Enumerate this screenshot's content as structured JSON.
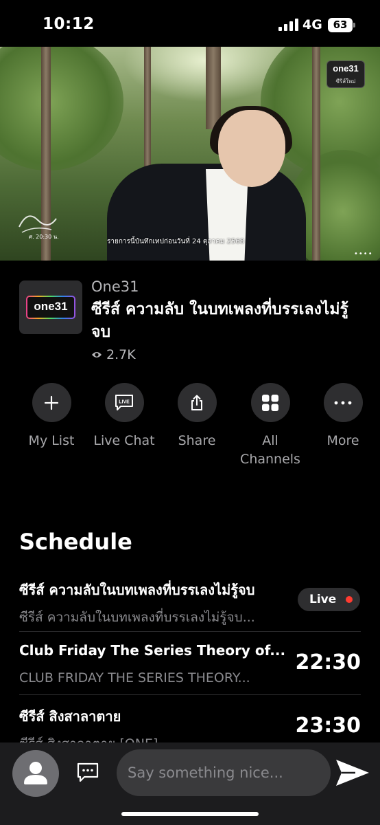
{
  "status_bar": {
    "time": "10:12",
    "network": "4G",
    "battery": "63"
  },
  "video": {
    "channel_logo": "one31",
    "channel_logo_sub": "ซีรีส์ใหม่",
    "watermark_time": "ศ. 20:30 น.",
    "subtitle": "รายการนี้บันทึกเทปก่อนวันที่ 24 ตุลาคม 2568",
    "more_dots": "••••"
  },
  "channel": {
    "badge": "one31",
    "name": "One31",
    "program_title": "ซีรีส์ ความลับ ในบทเพลงที่บรรเลงไม่รู้จบ",
    "views": "2.7K"
  },
  "actions": [
    {
      "label": "My List",
      "icon": "plus-icon"
    },
    {
      "label": "Live Chat",
      "icon": "live-chat-icon",
      "icon_text": "LIVE"
    },
    {
      "label": "Share",
      "icon": "share-icon"
    },
    {
      "label": "All Channels",
      "icon": "grid-icon"
    },
    {
      "label": "More",
      "icon": "ellipsis-icon"
    }
  ],
  "schedule": {
    "title": "Schedule",
    "items": [
      {
        "title": "ซีรีส์ ความลับในบทเพลงที่บรรเลงไม่รู้จบ",
        "subtitle": "ซีรีส์ ความลับในบทเพลงที่บรรเลงไม่รู้จบ...",
        "status": "Live"
      },
      {
        "title": "Club Friday The Series Theory of...",
        "subtitle": "CLUB FRIDAY THE SERIES THEORY...",
        "time": "22:30"
      },
      {
        "title": "ซีรีส์ สิงสาลาตาย",
        "subtitle": "ซีรีส์ สิงสาลาตาย [ONE]",
        "time": "23:30"
      }
    ]
  },
  "chat": {
    "placeholder": "Say something nice..."
  },
  "colors": {
    "background": "#000000",
    "live_dot": "#ff3b30",
    "secondary_text": "#8a8a8e",
    "button_bg": "#2e2e30"
  }
}
